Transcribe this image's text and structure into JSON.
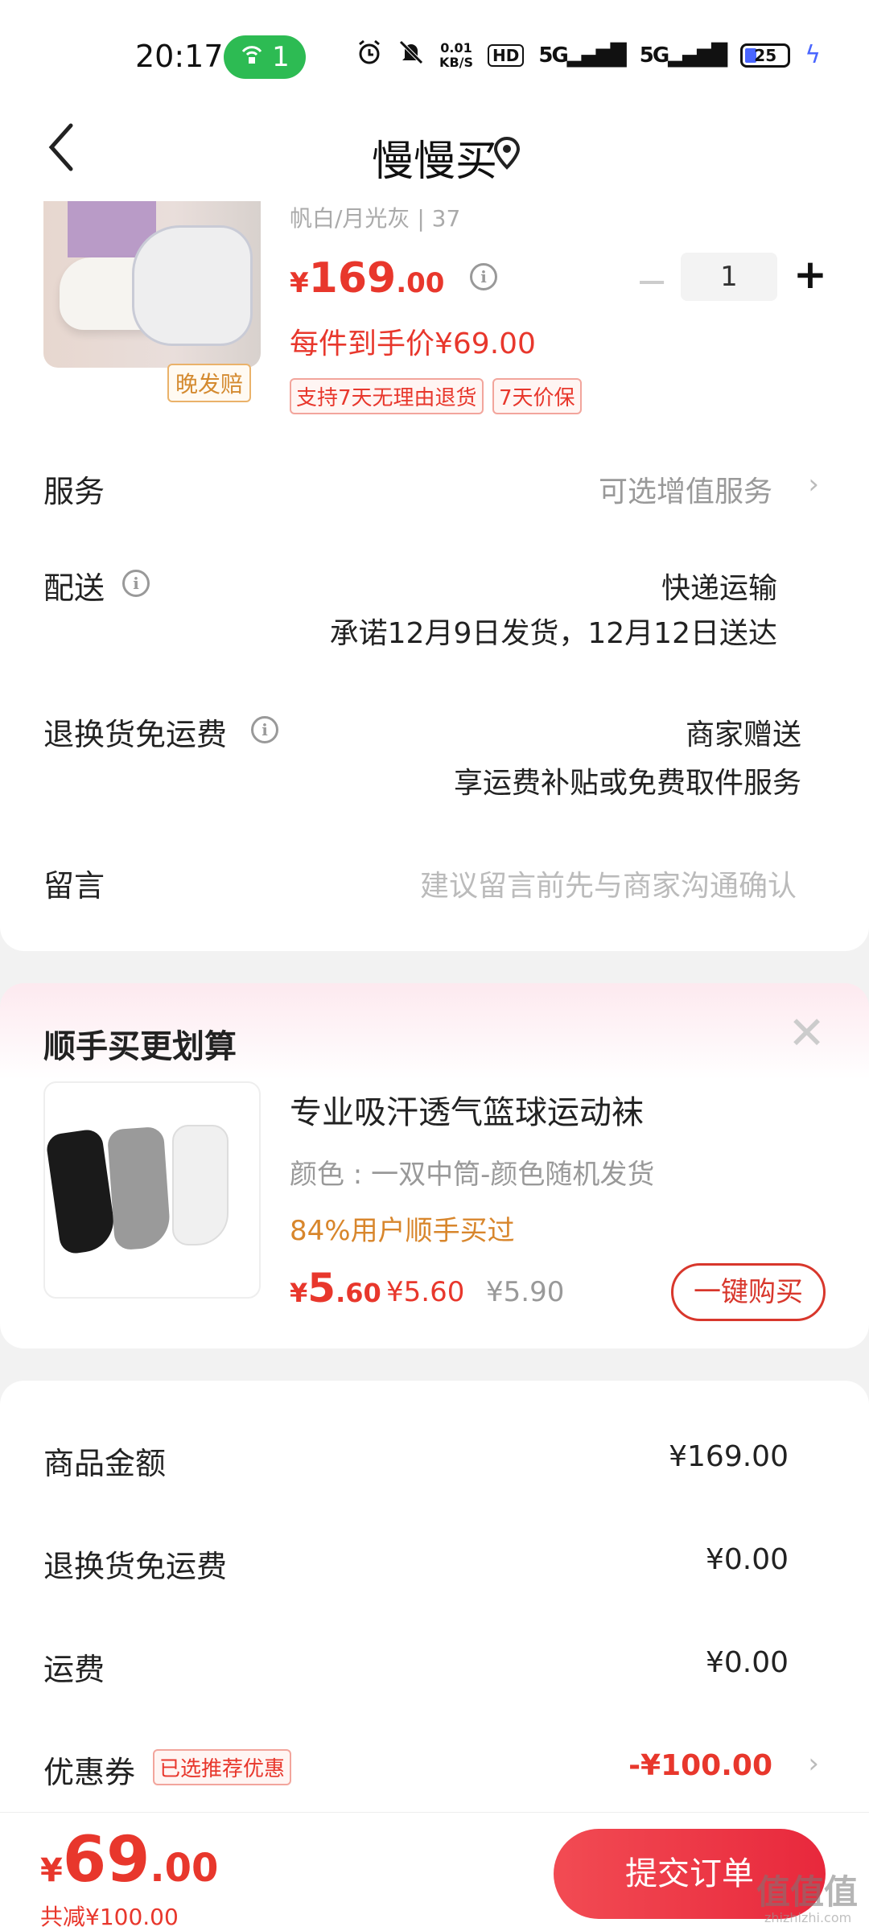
{
  "status_bar": {
    "time": "20:17",
    "hotspot_count": "1",
    "net_speed": "0.01",
    "net_unit": "KB/S",
    "hd_label": "HD",
    "signal1": "5G",
    "signal2": "5G",
    "battery": "25"
  },
  "nav": {
    "title": "慢慢买"
  },
  "product": {
    "variant": "帆白/月光灰 | 37",
    "price_yen": "¥",
    "price_int": "169",
    "price_dec": ".00",
    "quantity": "1",
    "each_price": "每件到手价¥69.00",
    "tags": [
      "支持7天无理由退货",
      "7天价保"
    ]
  },
  "rows": {
    "service_label": "服务",
    "service_value": "可选增值服务",
    "delivery_label": "配送",
    "delivery_tag": "晚发赔",
    "delivery_method": "快递运输",
    "delivery_promise": "承诺12月9日发货，12月12日送达",
    "return_label": "退换货免运费",
    "return_value1": "商家赠送",
    "return_value2": "享运费补贴或免费取件服务",
    "message_label": "留言",
    "message_placeholder": "建议留言前先与商家沟通确认"
  },
  "upsell": {
    "title": "顺手买更划算",
    "name": "专业吸汗透气篮球运动袜",
    "color": "颜色 : 一双中筒-颜色随机发货",
    "stat": "84%用户顺手买过",
    "price_yen": "¥",
    "price_int": "5",
    "price_dec": ".60",
    "price2": "¥5.60",
    "price3": "¥5.90",
    "buy_label": "一键购买"
  },
  "summary": {
    "goods_label": "商品金额",
    "goods_value": "¥169.00",
    "return_label": "退换货免运费",
    "return_value": "¥0.00",
    "shipping_label": "运费",
    "shipping_value": "¥0.00",
    "coupon_label": "优惠券",
    "coupon_tag": "已选推荐优惠",
    "coupon_value": "-¥100.00"
  },
  "bottom": {
    "total_yen": "¥",
    "total_int": "69",
    "total_dec": ".00",
    "saved": "共减¥100.00",
    "submit_label": "提交订单",
    "watermark": "值值值",
    "watermark_url": "zhizhizhi.com"
  },
  "colors": {
    "accent_red": "#e8372c",
    "orange": "#d8862c",
    "hotspot_green": "#2dbb53"
  }
}
